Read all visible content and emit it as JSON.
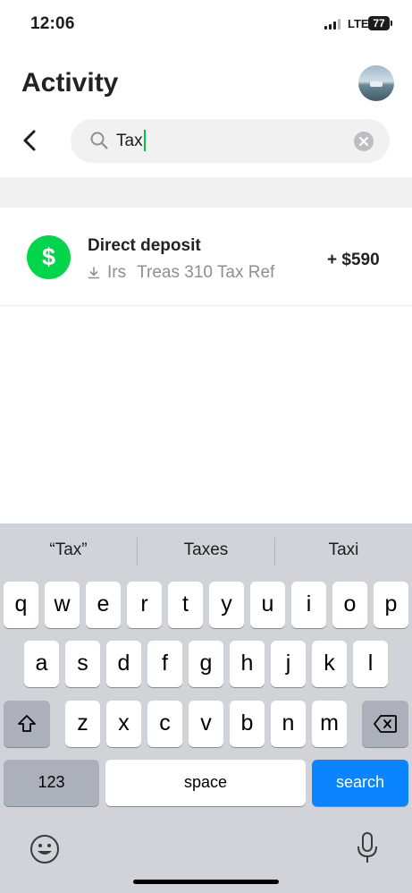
{
  "status_bar": {
    "time": "12:06",
    "network": "LTE",
    "battery": "77"
  },
  "header": {
    "title": "Activity"
  },
  "search": {
    "query": "Tax"
  },
  "results": [
    {
      "title": "Direct deposit",
      "subtitle_name": "Irs",
      "subtitle_detail": "Treas 310 Tax Ref",
      "amount": "+ $590",
      "icon_glyph": "$"
    }
  ],
  "colors": {
    "accent": "#00d54b",
    "cursor": "#00c244",
    "search_key": "#0a84ff"
  },
  "keyboard": {
    "suggestions": [
      "“Tax”",
      "Taxes",
      "Taxi"
    ],
    "row1": [
      "q",
      "w",
      "e",
      "r",
      "t",
      "y",
      "u",
      "i",
      "o",
      "p"
    ],
    "row2": [
      "a",
      "s",
      "d",
      "f",
      "g",
      "h",
      "j",
      "k",
      "l"
    ],
    "row3": [
      "z",
      "x",
      "c",
      "v",
      "b",
      "n",
      "m"
    ],
    "numbers_label": "123",
    "space_label": "space",
    "search_label": "search"
  }
}
